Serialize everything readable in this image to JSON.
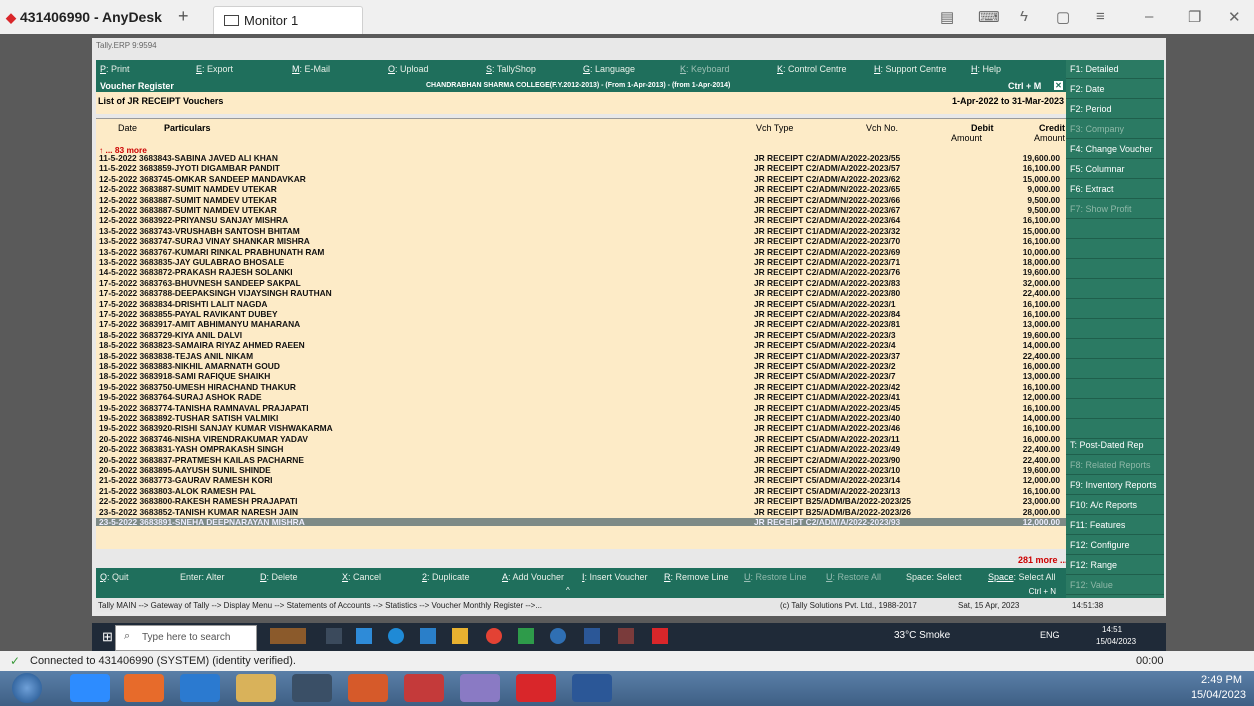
{
  "anydesk": {
    "title": "431406990 - AnyDesk",
    "plus": "+",
    "tab_label": "Monitor 1",
    "connection_status": "Connected to 431406990 (SYSTEM) (identity verified).",
    "session_timer": "00:00"
  },
  "tally": {
    "app_title": "Tally.ERP 9:9594",
    "top_buttons": [
      {
        "key": "P",
        "label": ": Print"
      },
      {
        "key": "E",
        "label": ": Export"
      },
      {
        "key": "M",
        "label": ": E-Mail"
      },
      {
        "key": "O",
        "label": ": Upload"
      },
      {
        "key": "S",
        "label": ": TallyShop"
      },
      {
        "key": "G",
        "label": ": Language"
      },
      {
        "key": "K",
        "label": ": Keyboard"
      },
      {
        "key": "K",
        "label": ": Control Centre"
      },
      {
        "key": "H",
        "label": ": Support Centre"
      },
      {
        "key": "H",
        "label": ": Help"
      }
    ],
    "report_name": "Voucher Register",
    "company_info": "CHANDRABHAN SHARMA COLLEGE(F.Y.2012-2013) - (From 1-Apr-2013) - (from 1-Apr-2014)",
    "ctrl_m": "Ctrl + M",
    "list_title": "List of JR RECEIPT Vouchers",
    "period": "1-Apr-2022 to 31-Mar-2023",
    "columns": {
      "date": "Date",
      "particulars": "Particulars",
      "vch_type": "Vch Type",
      "vch_no": "Vch No.",
      "debit": "Debit",
      "debit_sub": "Amount",
      "credit": "Credit",
      "credit_sub": "Amount"
    },
    "more_top": "↑ ... 83 more",
    "more_bottom": "281 more ... ↓",
    "rows": [
      {
        "p": "11-5-2022 3683843-SABINA JAVED ALI KHAN",
        "v": "JR RECEIPT C2/ADM/A/2022-2023/55",
        "c": "19,600.00"
      },
      {
        "p": "11-5-2022 3683859-JYOTI DIGAMBAR PANDIT",
        "v": "JR RECEIPT C2/ADM/A/2022-2023/57",
        "c": "16,100.00"
      },
      {
        "p": "12-5-2022 3683745-OMKAR SANDEEP MANDAVKAR",
        "v": "JR RECEIPT C2/ADM/A/2022-2023/62",
        "c": "15,000.00"
      },
      {
        "p": "12-5-2022 3683887-SUMIT NAMDEV UTEKAR",
        "v": "JR RECEIPT C2/ADM/N/2022-2023/65",
        "c": "9,000.00"
      },
      {
        "p": "12-5-2022 3683887-SUMIT NAMDEV UTEKAR",
        "v": "JR RECEIPT C2/ADM/N/2022-2023/66",
        "c": "9,500.00"
      },
      {
        "p": "12-5-2022 3683887-SUMIT NAMDEV UTEKAR",
        "v": "JR RECEIPT C2/ADM/N/2022-2023/67",
        "c": "9,500.00"
      },
      {
        "p": "12-5-2022 3683922-PRIYANSU SANJAY MISHRA",
        "v": "JR RECEIPT C2/ADM/A/2022-2023/64",
        "c": "16,100.00"
      },
      {
        "p": "13-5-2022 3683743-VRUSHABH SANTOSH BHITAM",
        "v": "JR RECEIPT C1/ADM/A/2022-2023/32",
        "c": "15,000.00"
      },
      {
        "p": "13-5-2022 3683747-SURAJ VINAY SHANKAR MISHRA",
        "v": "JR RECEIPT C2/ADM/A/2022-2023/70",
        "c": "16,100.00"
      },
      {
        "p": "13-5-2022 3683767-KUMARI RINKAL PRABHUNATH RAM",
        "v": "JR RECEIPT C2/ADM/A/2022-2023/69",
        "c": "10,000.00"
      },
      {
        "p": "13-5-2022 3683835-JAY GULABRAO BHOSALE",
        "v": "JR RECEIPT C2/ADM/A/2022-2023/71",
        "c": "18,000.00"
      },
      {
        "p": "14-5-2022 3683872-PRAKASH RAJESH SOLANKI",
        "v": "JR RECEIPT C2/ADM/A/2022-2023/76",
        "c": "19,600.00"
      },
      {
        "p": "17-5-2022 3683763-BHUVNESH SANDEEP SAKPAL",
        "v": "JR RECEIPT C2/ADM/A/2022-2023/83",
        "c": "32,000.00"
      },
      {
        "p": "17-5-2022 3683788-DEEPAKSINGH VIJAYSINGH RAUTHAN",
        "v": "JR RECEIPT C2/ADM/A/2022-2023/80",
        "c": "22,400.00"
      },
      {
        "p": "17-5-2022 3683834-DRISHTI LALIT NAGDA",
        "v": "JR RECEIPT C5/ADM/A/2022-2023/1",
        "c": "16,100.00"
      },
      {
        "p": "17-5-2022 3683855-PAYAL RAVIKANT DUBEY",
        "v": "JR RECEIPT C2/ADM/A/2022-2023/84",
        "c": "16,100.00"
      },
      {
        "p": "17-5-2022 3683917-AMIT ABHIMANYU MAHARANA",
        "v": "JR RECEIPT C2/ADM/A/2022-2023/81",
        "c": "13,000.00"
      },
      {
        "p": "18-5-2022 3683729-KIYA ANIL DALVI",
        "v": "JR RECEIPT C5/ADM/A/2022-2023/3",
        "c": "19,600.00"
      },
      {
        "p": "18-5-2022 3683823-SAMAIRA RIYAZ AHMED RAEEN",
        "v": "JR RECEIPT C5/ADM/A/2022-2023/4",
        "c": "14,000.00"
      },
      {
        "p": "18-5-2022 3683838-TEJAS ANIL NIKAM",
        "v": "JR RECEIPT C1/ADM/A/2022-2023/37",
        "c": "22,400.00"
      },
      {
        "p": "18-5-2022 3683883-NIKHIL AMARNATH GOUD",
        "v": "JR RECEIPT C5/ADM/A/2022-2023/2",
        "c": "16,000.00"
      },
      {
        "p": "18-5-2022 3683918-SAMI RAFIQUE SHAIKH",
        "v": "JR RECEIPT C5/ADM/A/2022-2023/7",
        "c": "13,000.00"
      },
      {
        "p": "19-5-2022 3683750-UMESH HIRACHAND THAKUR",
        "v": "JR RECEIPT C1/ADM/A/2022-2023/42",
        "c": "16,100.00"
      },
      {
        "p": "19-5-2022 3683764-SURAJ ASHOK RADE",
        "v": "JR RECEIPT C1/ADM/A/2022-2023/41",
        "c": "12,000.00"
      },
      {
        "p": "19-5-2022 3683774-TANISHA RAMNAVAL PRAJAPATI",
        "v": "JR RECEIPT C1/ADM/A/2022-2023/45",
        "c": "16,100.00"
      },
      {
        "p": "19-5-2022 3683892-TUSHAR SATISH VALMIKI",
        "v": "JR RECEIPT C1/ADM/A/2022-2023/40",
        "c": "14,000.00"
      },
      {
        "p": "19-5-2022 3683920-RISHI SANJAY KUMAR VISHWAKARMA",
        "v": "JR RECEIPT C1/ADM/A/2022-2023/46",
        "c": "16,100.00"
      },
      {
        "p": "20-5-2022 3683746-NISHA VIRENDRAKUMAR YADAV",
        "v": "JR RECEIPT C5/ADM/A/2022-2023/11",
        "c": "16,000.00"
      },
      {
        "p": "20-5-2022 3683831-YASH OMPRAKASH SINGH",
        "v": "JR RECEIPT C1/ADM/A/2022-2023/49",
        "c": "22,400.00"
      },
      {
        "p": "20-5-2022 3683837-PRATMESH KAILAS PACHARNE",
        "v": "JR RECEIPT C2/ADM/A/2022-2023/90",
        "c": "22,400.00"
      },
      {
        "p": "20-5-2022 3683895-AAYUSH SUNIL SHINDE",
        "v": "JR RECEIPT C5/ADM/A/2022-2023/10",
        "c": "19,600.00"
      },
      {
        "p": "21-5-2022 3683773-GAURAV RAMESH KORI",
        "v": "JR RECEIPT C5/ADM/A/2022-2023/14",
        "c": "12,000.00"
      },
      {
        "p": "21-5-2022 3683803-ALOK RAMESH PAL",
        "v": "JR RECEIPT C5/ADM/A/2022-2023/13",
        "c": "16,100.00"
      },
      {
        "p": "22-5-2022 3683800-RAKESH RAMESH PRAJAPATI",
        "v": "JR RECEIPT B25/ADM/BA/2022-2023/25",
        "c": "23,000.00"
      },
      {
        "p": "23-5-2022 3683852-TANISH KUMAR NARESH JAIN",
        "v": "JR RECEIPT B25/ADM/BA/2022-2023/26",
        "c": "28,000.00"
      },
      {
        "p": "23-5-2022 3683891-SNEHA DEEPNARAYAN MISHRA",
        "v": "JR RECEIPT C2/ADM/A/2022-2023/93",
        "c": "12,000.00"
      }
    ],
    "bottom_buttons": [
      {
        "key": "Q",
        "label": ": Quit"
      },
      {
        "key": "Enter",
        "label": ": Alter"
      },
      {
        "key": "D",
        "label": ": Delete"
      },
      {
        "key": "X",
        "label": ": Cancel"
      },
      {
        "key": "2",
        "label": ": Duplicate"
      },
      {
        "key": "A",
        "label": ": Add Voucher"
      },
      {
        "key": "I",
        "label": ": Insert Voucher"
      },
      {
        "key": "R",
        "label": ": Remove Line"
      },
      {
        "key": "U",
        "label": ": Restore Line"
      },
      {
        "key": "U",
        "label": ": Restore All"
      },
      {
        "key": "Space",
        "label": ": Select"
      },
      {
        "key": "Space",
        "label": ": Select All"
      }
    ],
    "ctrl_n": "Ctrl + N",
    "breadcrumb": "Tally MAIN --> Gateway of Tally --> Display Menu --> Statements of Accounts --> Statistics --> Voucher Monthly Register -->...",
    "copyright": "(c) Tally Solutions Pvt. Ltd., 1988-2017",
    "date": "Sat, 15 Apr, 2023",
    "time": "14:51:38",
    "right_buttons": [
      {
        "label": "F1: Detailed",
        "dim": false
      },
      {
        "label": "F2: Date",
        "dim": false
      },
      {
        "label": "F2: Period",
        "dim": false
      },
      {
        "label": "F3: Company",
        "dim": true
      },
      {
        "label": "F4: Change Voucher",
        "dim": false
      },
      {
        "label": "F5: Columnar",
        "dim": false
      },
      {
        "label": "F6: Extract",
        "dim": false
      },
      {
        "label": "F7: Show Profit",
        "dim": true
      },
      {
        "label": "T: Post-Dated Rep",
        "dim": false
      },
      {
        "label": "F8: Related Reports",
        "dim": true
      },
      {
        "label": "F9: Inventory Reports",
        "dim": false
      },
      {
        "label": "F10: A/c Reports",
        "dim": false
      },
      {
        "label": "F11: Features",
        "dim": false
      },
      {
        "label": "F12: Configure",
        "dim": false
      },
      {
        "label": "F12: Range",
        "dim": false
      },
      {
        "label": "F12: Value",
        "dim": true
      }
    ]
  },
  "remote_taskbar": {
    "search_placeholder": "Type here to search",
    "weather": "33°C Smoke",
    "lang": "ENG",
    "time": "14:51",
    "date": "15/04/2023"
  },
  "host_taskbar": {
    "time": "2:49 PM",
    "date": "15/04/2023"
  }
}
